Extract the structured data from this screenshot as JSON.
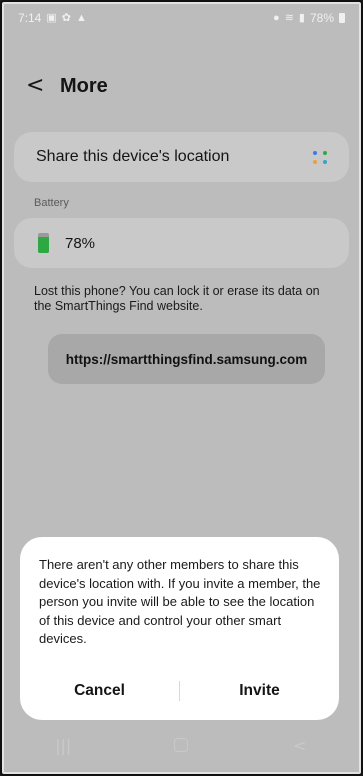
{
  "status_bar": {
    "time": "7:14",
    "battery_percent": "78%"
  },
  "header": {
    "title": "More"
  },
  "share_location": {
    "label": "Share this device's location"
  },
  "battery_section": {
    "label": "Battery",
    "value": "78%",
    "level": 0.78
  },
  "lost_phone": {
    "text": "Lost this phone? You can lock it or erase its data on the SmartThings Find website.",
    "link_label": "https://smartthingsfind.samsung.com"
  },
  "dialog": {
    "message": "There aren't any other members to share this device's location with. If you invite a member, the person you invite will be able to see the location of this device and control your other smart devices.",
    "cancel_label": "Cancel",
    "invite_label": "Invite"
  },
  "colors": {
    "battery_green": "#2ea843",
    "dots": [
      "#3b7be8",
      "#2ea843",
      "#e8a03b",
      "#2ea8c4"
    ]
  }
}
